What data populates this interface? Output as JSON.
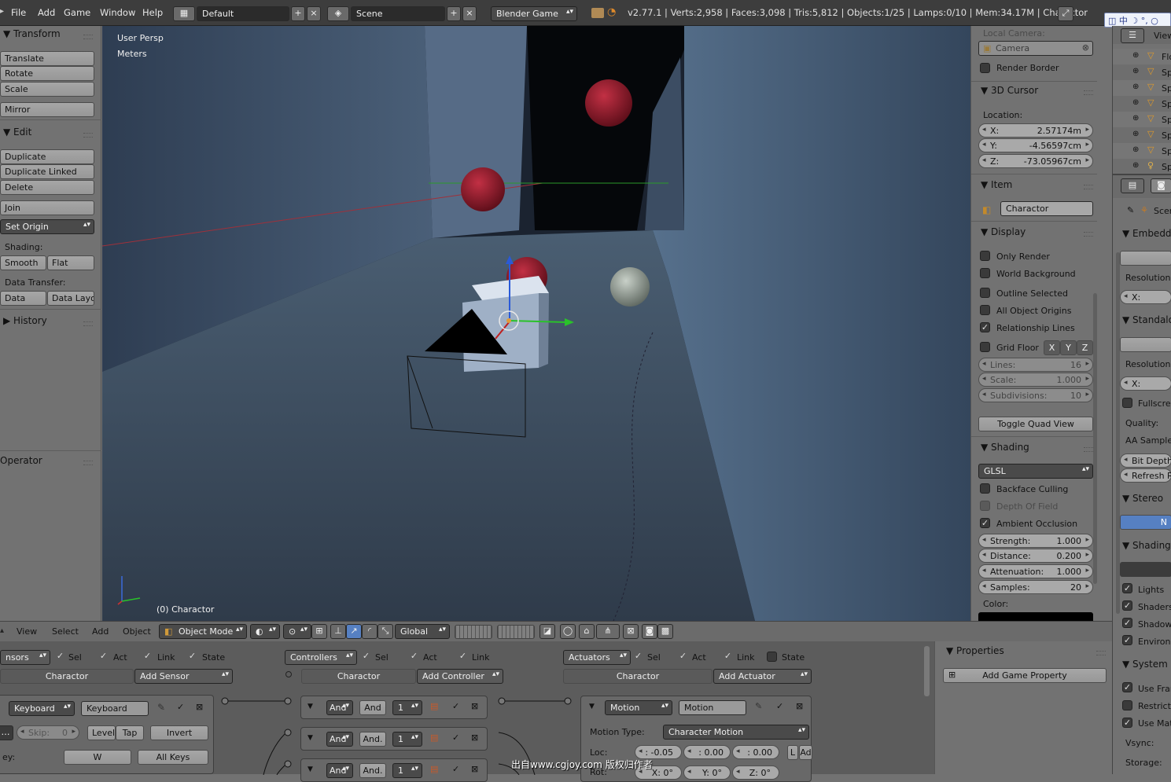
{
  "topbar": {
    "menus": [
      "File",
      "Add",
      "Game",
      "Window",
      "Help"
    ],
    "layout": "Default",
    "scene": "Scene",
    "engine": "Blender Game",
    "stats": "v2.77.1 | Verts:2,958 | Faces:3,098 | Tris:5,812 | Objects:1/25 | Lamps:0/10 | Mem:34.17M | Charactor",
    "ime": "中"
  },
  "toolshelf": {
    "transform_title": "Transform",
    "translate": "Translate",
    "rotate": "Rotate",
    "scale": "Scale",
    "mirror": "Mirror",
    "edit_title": "Edit",
    "duplicate": "Duplicate",
    "duplicate_linked": "Duplicate Linked",
    "delete": "Delete",
    "join": "Join",
    "set_origin": "Set Origin",
    "shading_label": "Shading:",
    "smooth": "Smooth",
    "flat": "Flat",
    "data_transfer_label": "Data Transfer:",
    "data": "Data",
    "data_layout": "Data Layo",
    "history_title": "History",
    "operator_title": "Operator"
  },
  "viewport": {
    "view_name": "User Persp",
    "units": "Meters",
    "object_label": "(0) Charactor",
    "watermark": "出自www.cgjoy.com 版权归作者"
  },
  "properties_n": {
    "local_camera_label": "Local Camera:",
    "camera": "Camera",
    "render_border": "Render Border",
    "cursor_title": "3D Cursor",
    "location_label": "Location:",
    "x_label": "X:",
    "x_value": "2.57174m",
    "y_label": "Y:",
    "y_value": "-4.56597cm",
    "z_label": "Z:",
    "z_value": "-73.05967cm",
    "item_title": "Item",
    "item_name": "Charactor",
    "display_title": "Display",
    "only_render": "Only Render",
    "world_background": "World Background",
    "outline_selected": "Outline Selected",
    "all_object_origins": "All Object Origins",
    "relationship_lines": "Relationship Lines",
    "grid_floor": "Grid Floor",
    "axis_x": "X",
    "axis_y": "Y",
    "axis_z": "Z",
    "lines_label": "Lines:",
    "lines_value": "16",
    "scale_label": "Scale:",
    "scale_value": "1.000",
    "subdiv_label": "Subdivisions:",
    "subdiv_value": "10",
    "toggle_quad": "Toggle Quad View",
    "shading_title": "Shading",
    "shading_mode": "GLSL",
    "backface_culling": "Backface Culling",
    "depth_of_field": "Depth Of Field",
    "ambient_occlusion": "Ambient Occlusion",
    "strength_label": "Strength:",
    "strength_value": "1.000",
    "distance_label": "Distance:",
    "distance_value": "0.200",
    "attenuation_label": "Attenuation:",
    "attenuation_value": "1.000",
    "samples_label": "Samples:",
    "samples_value": "20",
    "color_label": "Color:"
  },
  "outliner": {
    "view": "View",
    "items": [
      "Flo",
      "Sp",
      "Sp",
      "Sp",
      "Sp",
      "Sp",
      "Sp",
      "Sp"
    ]
  },
  "render_props": {
    "scene_tab": "Scen",
    "embedded": "Embedde",
    "resolution": "Resolution:",
    "x": "X:",
    "standalone": "Standalo",
    "fullscreen": "Fullscree",
    "quality": "Quality:",
    "aa_samples": "AA Samples",
    "bit_depth": "Bit Depth:",
    "refresh_rate": "Refresh Ra",
    "stereo": "Stereo",
    "stereo_btn": "N",
    "shading": "Shading",
    "lights": "Lights",
    "shaders": "Shaders",
    "shadows": "Shadows",
    "environment": "Environm",
    "system": "System",
    "use_frame": "Use Fran",
    "restrict": "Restrict",
    "use_material": "Use Mat",
    "vsync": "Vsync:",
    "storage": "Storage:"
  },
  "viewheader": {
    "view": "View",
    "select": "Select",
    "add": "Add",
    "object": "Object",
    "mode": "Object Mode",
    "orientation": "Global"
  },
  "logic": {
    "sensors": "nsors",
    "controllers": "Controllers",
    "actuators": "Actuators",
    "sel": "Sel",
    "act": "Act",
    "link": "Link",
    "state": "State",
    "object_name": "Charactor",
    "add_sensor": "Add Sensor",
    "add_controller": "Add Controller",
    "add_actuator": "Add Actuator",
    "sensor_type": "Keyboard",
    "sensor_name": "Keyboard",
    "skip_label": "Skip:",
    "skip_value": "0",
    "level": "Level",
    "tap": "Tap",
    "invert": "Invert",
    "key_label": "ey:",
    "key_value": "W",
    "all_keys": "All Keys",
    "ctrl_type": "And",
    "ctrl_name_1": "And",
    "ctrl_name_2": "And.",
    "ctrl_name_3": "And.",
    "ctrl_state": "1",
    "act_type": "Motion",
    "act_name": "Motion",
    "motion_type_label": "Motion Type:",
    "motion_type": "Character Motion",
    "loc_label": "Loc:",
    "loc_x": ": -0.05",
    "loc_y": ": 0.00",
    "loc_z": ": 0.00",
    "l_btn": "L",
    "ad_btn": "Ad",
    "rot_label": "Rot:",
    "rot_x": "X: 0°",
    "rot_y": "Y: 0°",
    "rot_z": "Z: 0°",
    "properties_title": "Properties",
    "add_game_property": "Add Game Property"
  }
}
